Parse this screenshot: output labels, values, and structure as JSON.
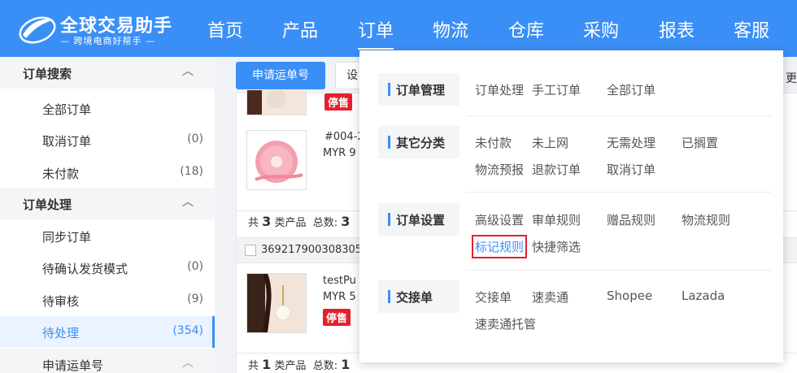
{
  "app": {
    "logo_title": "全球交易助手",
    "logo_subtitle": "— 跨境电商好帮手 —",
    "accent_color": "#3a8ff7"
  },
  "nav": [
    "首页",
    "产品",
    "订单",
    "物流",
    "仓库",
    "采购",
    "报表",
    "客服"
  ],
  "sidebar": {
    "sections": [
      {
        "title": "订单搜索",
        "items": [
          {
            "label": "全部订单",
            "count": ""
          },
          {
            "label": "取消订单",
            "count": "(0)"
          },
          {
            "label": "未付款",
            "count": "(18)"
          }
        ]
      },
      {
        "title": "订单处理",
        "items": [
          {
            "label": "同步订单",
            "count": ""
          },
          {
            "label": "待确认发货模式",
            "count": "(0)"
          },
          {
            "label": "待审核",
            "count": "(9)"
          },
          {
            "label": "待处理",
            "count": "(354)"
          }
        ]
      },
      {
        "title": "申请运单号"
      }
    ]
  },
  "toolbar": {
    "apply_label": "申请运单号",
    "settings_label": "设",
    "more_label": "更多"
  },
  "orders": {
    "p1_badge": "停售",
    "p2_sku": "#004-2",
    "p2_price": "MYR 9",
    "summary1": {
      "a": "共",
      "types": "3",
      "b": "类产品",
      "c": "总数:",
      "total": "3"
    },
    "order_no": "369217900308305",
    "p3_name": "testPu",
    "p3_price": "MYR 5",
    "p3_badge": "停售",
    "summary2": {
      "a": "共",
      "types": "1",
      "b": "类产品",
      "c": "总数:",
      "total": "1"
    }
  },
  "menu": {
    "groups": [
      {
        "title": "订单管理",
        "links": [
          "订单处理",
          "手工订单",
          "全部订单"
        ]
      },
      {
        "title": "其它分类",
        "links": [
          "未付款",
          "未上网",
          "无需处理",
          "已搁置",
          "物流预报",
          "退款订单",
          "取消订单"
        ]
      },
      {
        "title": "订单设置",
        "links": [
          "高级设置",
          "审单规则",
          "赠品规则",
          "物流规则",
          "标记规则",
          "快捷筛选"
        ]
      },
      {
        "title": "交接单",
        "links": [
          "交接单",
          "速卖通",
          "Shopee",
          "Lazada",
          "速卖通托管"
        ]
      }
    ],
    "highlighted": "标记规则"
  }
}
